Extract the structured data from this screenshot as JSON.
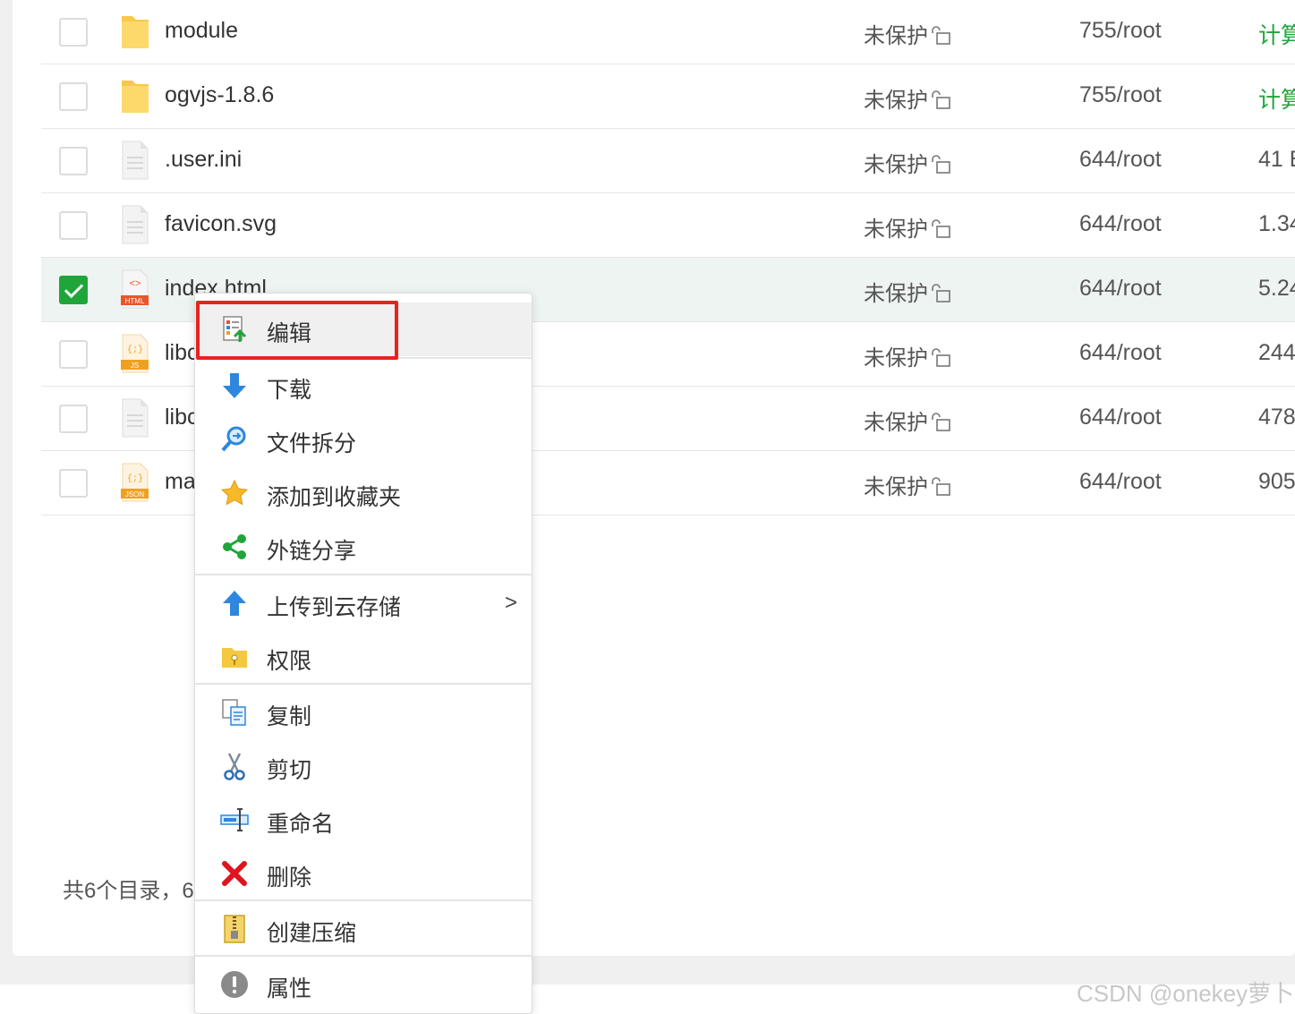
{
  "files": [
    {
      "name": "module",
      "protection": "未保护",
      "perm": "755/root",
      "size": "计算",
      "type": "folder",
      "checked": false
    },
    {
      "name": "ogvjs-1.8.6",
      "protection": "未保护",
      "perm": "755/root",
      "size": "计算",
      "type": "folder",
      "checked": false
    },
    {
      "name": ".user.ini",
      "protection": "未保护",
      "perm": "644/root",
      "size": "41 B",
      "type": "text",
      "checked": false
    },
    {
      "name": "favicon.svg",
      "protection": "未保护",
      "perm": "644/root",
      "size": "1.34",
      "type": "text",
      "checked": false
    },
    {
      "name": "index.html",
      "protection": "未保护",
      "perm": "644/root",
      "size": "5.24",
      "type": "html",
      "checked": true
    },
    {
      "name": "libc",
      "protection": "未保护",
      "perm": "644/root",
      "size": "244",
      "type": "js",
      "checked": false
    },
    {
      "name": "libc",
      "protection": "未保护",
      "perm": "644/root",
      "size": "478",
      "type": "text",
      "checked": false
    },
    {
      "name": "ma",
      "protection": "未保护",
      "perm": "644/root",
      "size": "905",
      "type": "json",
      "checked": false
    }
  ],
  "icon_badges": {
    "html": "HTML",
    "js": "JS",
    "json": "JSON",
    "code_glyph": "{;}",
    "html_glyph": "<>"
  },
  "footer": {
    "summary": "共6个目录，6"
  },
  "context_menu": {
    "items": [
      {
        "label": "编辑",
        "icon": "edit-icon",
        "highlighted": true
      },
      {
        "label": "下载",
        "icon": "download-icon"
      },
      {
        "label": "文件拆分",
        "icon": "split-icon"
      },
      {
        "label": "添加到收藏夹",
        "icon": "star-icon"
      },
      {
        "label": "外链分享",
        "icon": "share-icon"
      },
      {
        "label": "上传到云存储",
        "icon": "upload-cloud-icon",
        "submenu": ">"
      },
      {
        "label": "权限",
        "icon": "permission-icon"
      },
      {
        "label": "复制",
        "icon": "copy-icon"
      },
      {
        "label": "剪切",
        "icon": "scissors-icon"
      },
      {
        "label": "重命名",
        "icon": "rename-icon"
      },
      {
        "label": "删除",
        "icon": "delete-icon"
      },
      {
        "label": "创建压缩",
        "icon": "zip-icon"
      },
      {
        "label": "属性",
        "icon": "info-icon"
      }
    ]
  },
  "watermark": "CSDN @onekey萝卜",
  "colors": {
    "accent": "#20a53a",
    "highlight_border": "#e8231f"
  }
}
